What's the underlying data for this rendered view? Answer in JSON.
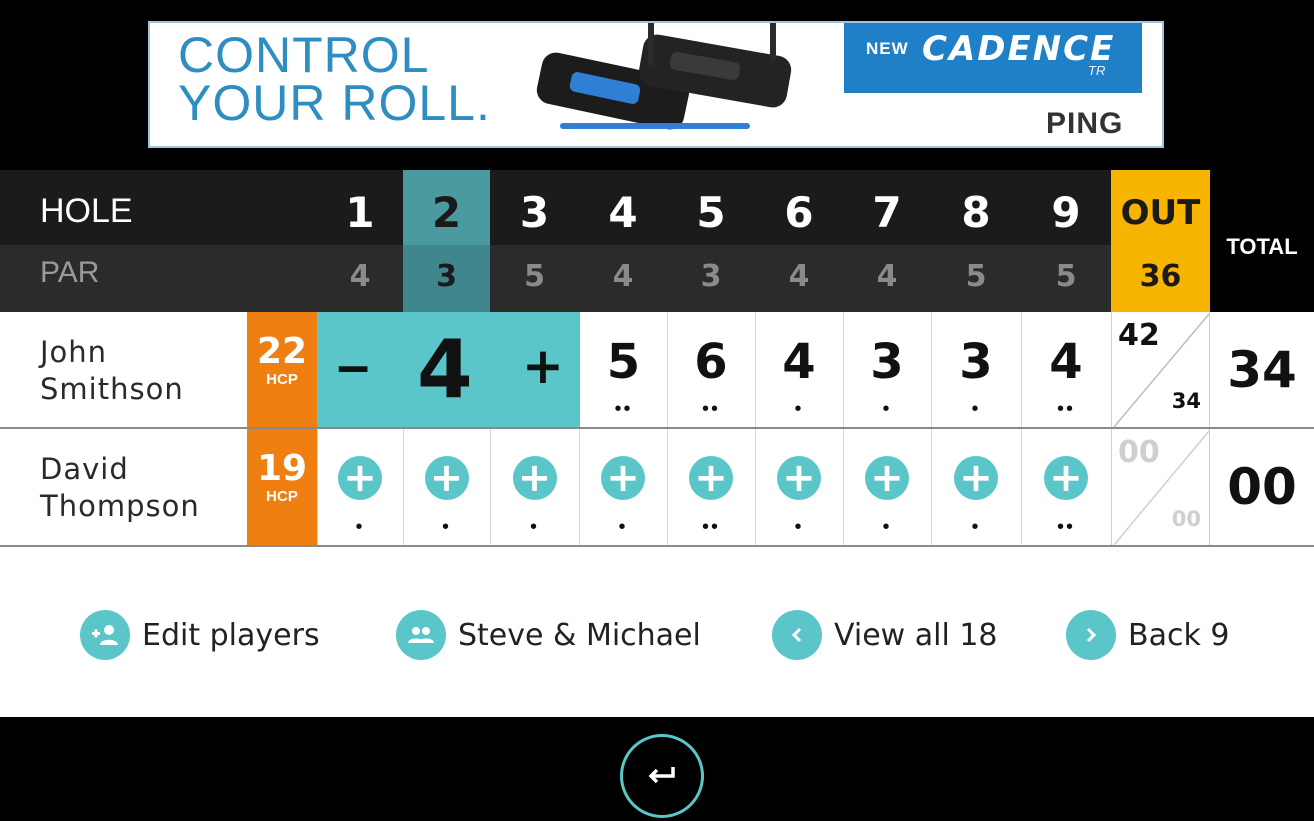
{
  "ad": {
    "headline_line1": "CONTROL",
    "headline_line2": "YOUR ROLL.",
    "new_label": "NEW",
    "product": "CADENCE",
    "product_suffix": "TR",
    "brand": "PING"
  },
  "scorecard": {
    "hole_label": "HOLE",
    "par_label": "PAR",
    "holes": [
      "1",
      "2",
      "3",
      "4",
      "5",
      "6",
      "7",
      "8",
      "9"
    ],
    "pars": [
      "4",
      "3",
      "5",
      "4",
      "3",
      "4",
      "4",
      "5",
      "5"
    ],
    "selected_hole": "2",
    "out_label": "OUT",
    "out_par": "36",
    "total_label": "TOTAL"
  },
  "players": [
    {
      "name_line1": "John",
      "name_line2": "Smithson",
      "hcp": "22",
      "hcp_label": "HCP",
      "active_score": "4",
      "minus_label": "–",
      "plus_label": "+",
      "scores": [
        "5",
        "6",
        "4",
        "3",
        "3",
        "4"
      ],
      "out_gross": "42",
      "out_net": "34",
      "total": "34",
      "dots": [
        "•",
        "•",
        "•",
        "••",
        "•",
        "•",
        "••",
        "•",
        "•",
        "••"
      ]
    },
    {
      "name_line1": "David",
      "name_line2": "Thompson",
      "hcp": "19",
      "hcp_label": "HCP",
      "out_gross": "00",
      "out_net": "00",
      "total": "00"
    }
  ],
  "dots": [
    "•",
    "•",
    "•",
    "•",
    "••",
    "•",
    "•",
    "•",
    "••"
  ],
  "actions": {
    "edit_players": "Edit players",
    "group": "Steve & Michael",
    "view_all": "View all 18",
    "back_nine": "Back 9"
  },
  "icons": {
    "add_player": "add-person-icon",
    "group": "group-icon",
    "prev": "chevron-left-icon",
    "next": "chevron-right-icon",
    "enter": "return-icon"
  },
  "colors": {
    "teal": "#5bc6ca",
    "orange": "#f07f12",
    "gold": "#f7b400"
  }
}
